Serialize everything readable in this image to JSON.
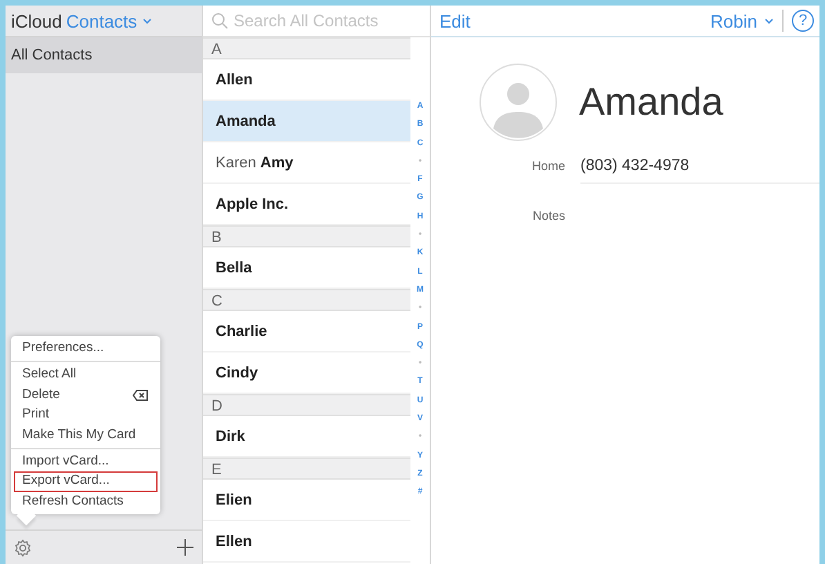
{
  "header": {
    "brand": "iCloud",
    "app": "Contacts",
    "search_placeholder": "Search All Contacts",
    "edit": "Edit",
    "user": "Robin",
    "help": "?"
  },
  "sidebar": {
    "groups": [
      {
        "label": "All Contacts",
        "selected": true
      }
    ]
  },
  "menu": {
    "items": [
      {
        "label": "Preferences...",
        "kind": "item",
        "highlighted": false
      },
      {
        "kind": "separator"
      },
      {
        "label": "Select All",
        "kind": "item",
        "highlighted": false
      },
      {
        "label": "Delete",
        "kind": "delete",
        "highlighted": false
      },
      {
        "label": "Print",
        "kind": "item",
        "highlighted": false
      },
      {
        "label": "Make This My Card",
        "kind": "item",
        "highlighted": false
      },
      {
        "kind": "separator"
      },
      {
        "label": "Import vCard...",
        "kind": "item",
        "highlighted": false
      },
      {
        "label": "Export vCard...",
        "kind": "item",
        "highlighted": true
      },
      {
        "label": "Refresh Contacts",
        "kind": "item",
        "highlighted": false
      }
    ]
  },
  "contacts": [
    {
      "kind": "section",
      "label": "A"
    },
    {
      "kind": "contact",
      "last": "Allen",
      "selected": false
    },
    {
      "kind": "contact",
      "last": "Amanda",
      "selected": true
    },
    {
      "kind": "contact",
      "first": "Karen",
      "last": "Amy",
      "selected": false
    },
    {
      "kind": "contact",
      "last": "Apple Inc.",
      "selected": false
    },
    {
      "kind": "section",
      "label": "B"
    },
    {
      "kind": "contact",
      "last": "Bella",
      "selected": false
    },
    {
      "kind": "section",
      "label": "C"
    },
    {
      "kind": "contact",
      "last": "Charlie",
      "selected": false
    },
    {
      "kind": "contact",
      "last": "Cindy",
      "selected": false
    },
    {
      "kind": "section",
      "label": "D"
    },
    {
      "kind": "contact",
      "last": "Dirk",
      "selected": false
    },
    {
      "kind": "section",
      "label": "E"
    },
    {
      "kind": "contact",
      "last": "Elien",
      "selected": false
    },
    {
      "kind": "contact",
      "last": "Ellen",
      "selected": false
    }
  ],
  "index": [
    "A",
    "B",
    "C",
    "•",
    "F",
    "G",
    "H",
    "•",
    "K",
    "L",
    "M",
    "•",
    "P",
    "Q",
    "•",
    "T",
    "U",
    "V",
    "•",
    "Y",
    "Z",
    "#"
  ],
  "detail": {
    "name": "Amanda",
    "fields": [
      {
        "label": "Home",
        "value": "(803) 432-4978"
      },
      {
        "label": "Notes"
      }
    ]
  }
}
